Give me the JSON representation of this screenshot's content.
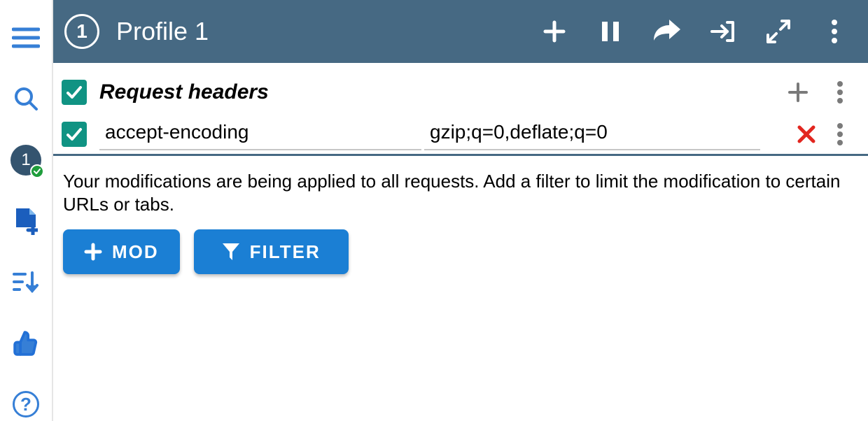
{
  "sidebar": {
    "profile_chip": "1"
  },
  "appbar": {
    "profile_number": "1",
    "title": "Profile 1"
  },
  "section": {
    "title": "Request headers"
  },
  "headers": [
    {
      "name": "accept-encoding",
      "value": "gzip;q=0,deflate;q=0"
    }
  ],
  "info": {
    "text": "Your modifications are being applied to all requests. Add a filter to limit the modification to certain URLs or tabs.",
    "mod_label": "MOD",
    "filter_label": "FILTER"
  }
}
